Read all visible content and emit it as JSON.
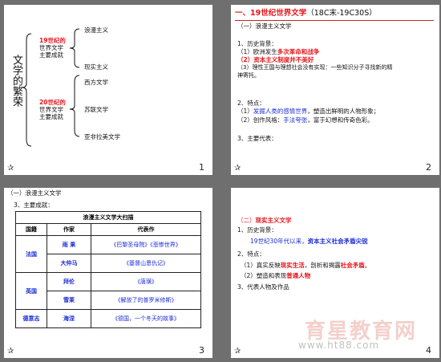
{
  "slides": [
    {
      "number": "1",
      "vertical_title": "文学的繁荣",
      "branch1": {
        "line1": "19世纪的",
        "line2": "世界文学",
        "line3": "主要成就"
      },
      "branch2": {
        "line1": "20世纪的",
        "line2": "世界文学",
        "line3": "主要成就"
      },
      "leaves1": [
        "浪漫主义",
        "现实主义"
      ],
      "leaves2": [
        "西方文学",
        "苏联文学",
        "亚非拉美文学"
      ]
    },
    {
      "number": "2",
      "title": "一、19世纪世界文学",
      "title_suffix": "（18C末-19C30S）",
      "subtitle": "（一）浪漫主义文学",
      "bg_head": "1、历史背景：",
      "bg1": "（1）欧洲发生",
      "bg1_red": "多次革命和战争",
      "bg2": "（2）资本主义制度并不美好",
      "bg3a": "（3）理性王国与理想社会没有实现：一些知识分子寻找新的精",
      "bg3b": "神寄托。",
      "feat_head": "2、特点：",
      "f1a": "（1）",
      "f1b": "发掘人类的感情世界",
      "f1c": "，塑造出鲜明的人物形象；",
      "f2a": "（2）创作风格：",
      "f2b": "手法夸张",
      "f2c": "，富于幻想和传奇色彩。",
      "ach_head": "3、主要代表："
    },
    {
      "number": "3",
      "header": "（一）浪漫主义文学",
      "subhead": "3、主要成就：",
      "table_title": "浪漫主义文学大扫描",
      "table_headers": [
        "国籍",
        "作家",
        "代表作"
      ],
      "rows": [
        {
          "country": "法国",
          "author": "雨 果",
          "work": "《巴黎圣母院》《悲惨世界》"
        },
        {
          "country": "",
          "author": "大仲马",
          "work": "《基督山恩仇记》"
        },
        {
          "country": "英国",
          "author": "拜伦",
          "work": "《唐璜》"
        },
        {
          "country": "",
          "author": "雪莱",
          "work": "《解放了的普罗米修斯》"
        },
        {
          "country": "德意志",
          "author": "海涅",
          "work": "《德国，一个冬天的故事》"
        }
      ]
    },
    {
      "number": "4",
      "header_prefix": "（二）",
      "header_text": "现实主义文学",
      "s1_head": "1、历史背景：",
      "s1_body_a": "19世纪30年代以来，",
      "s1_body_b": "资本主义社会矛盾尖锐",
      "s2_head": "2、特点：",
      "p1a": "（1）真实反映",
      "p1b": "现实生活",
      "p1c": "，剖析和揭露",
      "p1d": "社会矛盾",
      "p1e": "。",
      "p2a": "（2）塑造和表现",
      "p2b": "普通人物",
      "s3_head": "3、代表人物及作品"
    }
  ],
  "watermark": {
    "cn": "育星教育网",
    "url": "www.ht88.com"
  },
  "icon": "star-icon"
}
